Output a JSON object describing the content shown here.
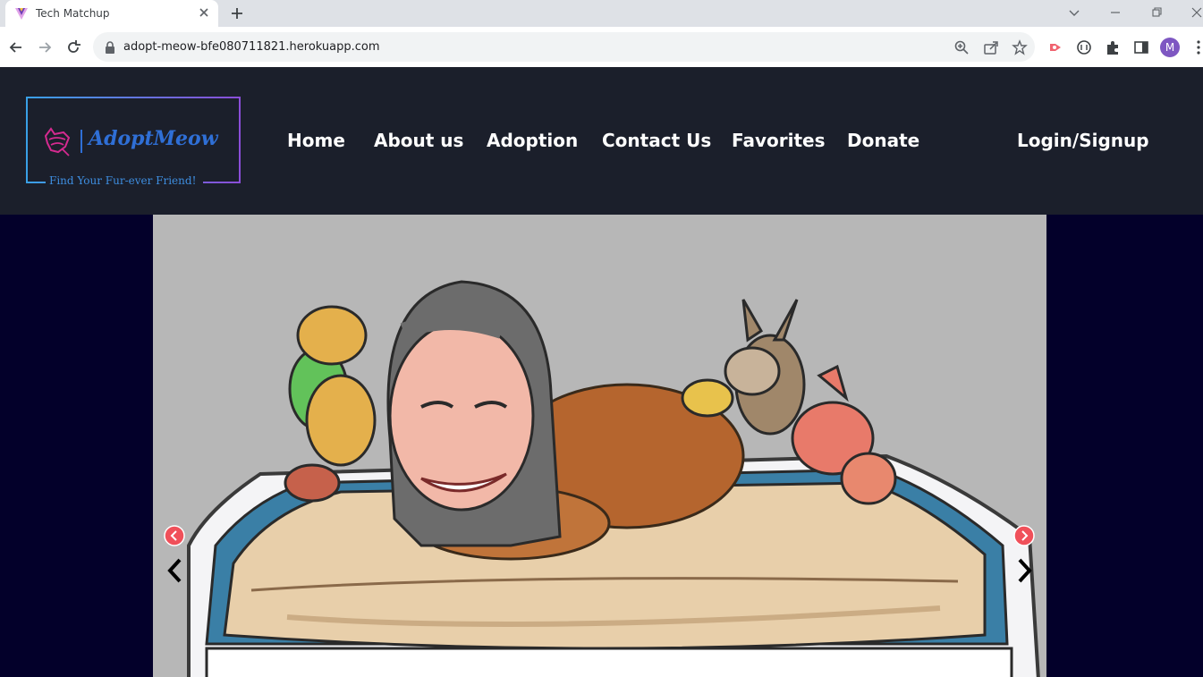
{
  "browser": {
    "tab_title": "Tech Matchup",
    "url": "adopt-meow-bfe080711821.herokuapp.com",
    "profile_initial": "M"
  },
  "logo": {
    "name": "AdoptMeow",
    "tagline": "Find Your Fur-ever Friend!"
  },
  "nav": {
    "items": [
      "Home",
      "About us",
      "Adoption",
      "Contact Us",
      "Favorites",
      "Donate"
    ],
    "login": "Login/Signup"
  },
  "colors": {
    "header_bg": "#1b1f2b",
    "page_bg": "#03002a",
    "brand_blue": "#2f6fd6",
    "hero_bg": "#b7b7b7"
  }
}
